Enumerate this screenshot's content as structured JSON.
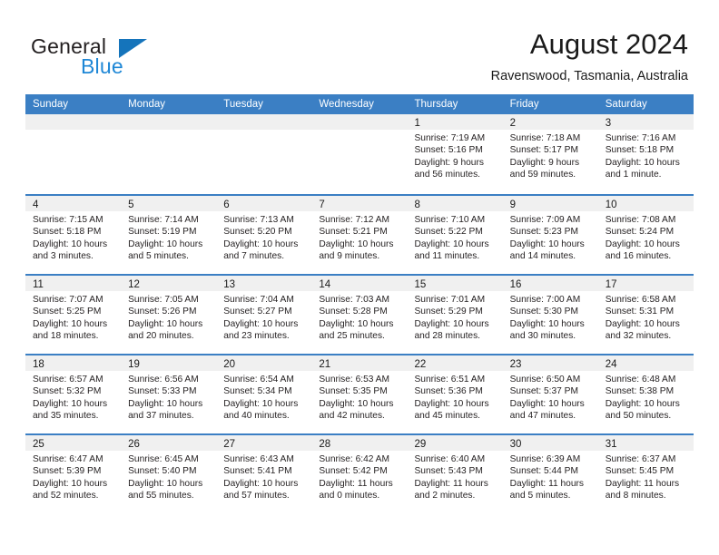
{
  "brand": {
    "name_top": "General",
    "name_bottom": "Blue",
    "triangle_color": "#1574bb",
    "blue_color": "#1e87d6"
  },
  "header": {
    "title": "August 2024",
    "subtitle": "Ravenswood, Tasmania, Australia"
  },
  "theme": {
    "header_blue": "#3b7fc4",
    "day_head_gray": "#f0f0f0",
    "text": "#231f20"
  },
  "weekdays": [
    "Sunday",
    "Monday",
    "Tuesday",
    "Wednesday",
    "Thursday",
    "Friday",
    "Saturday"
  ],
  "weeks": [
    [
      {
        "day": "",
        "lines": []
      },
      {
        "day": "",
        "lines": []
      },
      {
        "day": "",
        "lines": []
      },
      {
        "day": "",
        "lines": []
      },
      {
        "day": "1",
        "lines": [
          "Sunrise: 7:19 AM",
          "Sunset: 5:16 PM",
          "Daylight: 9 hours",
          "and 56 minutes."
        ]
      },
      {
        "day": "2",
        "lines": [
          "Sunrise: 7:18 AM",
          "Sunset: 5:17 PM",
          "Daylight: 9 hours",
          "and 59 minutes."
        ]
      },
      {
        "day": "3",
        "lines": [
          "Sunrise: 7:16 AM",
          "Sunset: 5:18 PM",
          "Daylight: 10 hours",
          "and 1 minute."
        ]
      }
    ],
    [
      {
        "day": "4",
        "lines": [
          "Sunrise: 7:15 AM",
          "Sunset: 5:18 PM",
          "Daylight: 10 hours",
          "and 3 minutes."
        ]
      },
      {
        "day": "5",
        "lines": [
          "Sunrise: 7:14 AM",
          "Sunset: 5:19 PM",
          "Daylight: 10 hours",
          "and 5 minutes."
        ]
      },
      {
        "day": "6",
        "lines": [
          "Sunrise: 7:13 AM",
          "Sunset: 5:20 PM",
          "Daylight: 10 hours",
          "and 7 minutes."
        ]
      },
      {
        "day": "7",
        "lines": [
          "Sunrise: 7:12 AM",
          "Sunset: 5:21 PM",
          "Daylight: 10 hours",
          "and 9 minutes."
        ]
      },
      {
        "day": "8",
        "lines": [
          "Sunrise: 7:10 AM",
          "Sunset: 5:22 PM",
          "Daylight: 10 hours",
          "and 11 minutes."
        ]
      },
      {
        "day": "9",
        "lines": [
          "Sunrise: 7:09 AM",
          "Sunset: 5:23 PM",
          "Daylight: 10 hours",
          "and 14 minutes."
        ]
      },
      {
        "day": "10",
        "lines": [
          "Sunrise: 7:08 AM",
          "Sunset: 5:24 PM",
          "Daylight: 10 hours",
          "and 16 minutes."
        ]
      }
    ],
    [
      {
        "day": "11",
        "lines": [
          "Sunrise: 7:07 AM",
          "Sunset: 5:25 PM",
          "Daylight: 10 hours",
          "and 18 minutes."
        ]
      },
      {
        "day": "12",
        "lines": [
          "Sunrise: 7:05 AM",
          "Sunset: 5:26 PM",
          "Daylight: 10 hours",
          "and 20 minutes."
        ]
      },
      {
        "day": "13",
        "lines": [
          "Sunrise: 7:04 AM",
          "Sunset: 5:27 PM",
          "Daylight: 10 hours",
          "and 23 minutes."
        ]
      },
      {
        "day": "14",
        "lines": [
          "Sunrise: 7:03 AM",
          "Sunset: 5:28 PM",
          "Daylight: 10 hours",
          "and 25 minutes."
        ]
      },
      {
        "day": "15",
        "lines": [
          "Sunrise: 7:01 AM",
          "Sunset: 5:29 PM",
          "Daylight: 10 hours",
          "and 28 minutes."
        ]
      },
      {
        "day": "16",
        "lines": [
          "Sunrise: 7:00 AM",
          "Sunset: 5:30 PM",
          "Daylight: 10 hours",
          "and 30 minutes."
        ]
      },
      {
        "day": "17",
        "lines": [
          "Sunrise: 6:58 AM",
          "Sunset: 5:31 PM",
          "Daylight: 10 hours",
          "and 32 minutes."
        ]
      }
    ],
    [
      {
        "day": "18",
        "lines": [
          "Sunrise: 6:57 AM",
          "Sunset: 5:32 PM",
          "Daylight: 10 hours",
          "and 35 minutes."
        ]
      },
      {
        "day": "19",
        "lines": [
          "Sunrise: 6:56 AM",
          "Sunset: 5:33 PM",
          "Daylight: 10 hours",
          "and 37 minutes."
        ]
      },
      {
        "day": "20",
        "lines": [
          "Sunrise: 6:54 AM",
          "Sunset: 5:34 PM",
          "Daylight: 10 hours",
          "and 40 minutes."
        ]
      },
      {
        "day": "21",
        "lines": [
          "Sunrise: 6:53 AM",
          "Sunset: 5:35 PM",
          "Daylight: 10 hours",
          "and 42 minutes."
        ]
      },
      {
        "day": "22",
        "lines": [
          "Sunrise: 6:51 AM",
          "Sunset: 5:36 PM",
          "Daylight: 10 hours",
          "and 45 minutes."
        ]
      },
      {
        "day": "23",
        "lines": [
          "Sunrise: 6:50 AM",
          "Sunset: 5:37 PM",
          "Daylight: 10 hours",
          "and 47 minutes."
        ]
      },
      {
        "day": "24",
        "lines": [
          "Sunrise: 6:48 AM",
          "Sunset: 5:38 PM",
          "Daylight: 10 hours",
          "and 50 minutes."
        ]
      }
    ],
    [
      {
        "day": "25",
        "lines": [
          "Sunrise: 6:47 AM",
          "Sunset: 5:39 PM",
          "Daylight: 10 hours",
          "and 52 minutes."
        ]
      },
      {
        "day": "26",
        "lines": [
          "Sunrise: 6:45 AM",
          "Sunset: 5:40 PM",
          "Daylight: 10 hours",
          "and 55 minutes."
        ]
      },
      {
        "day": "27",
        "lines": [
          "Sunrise: 6:43 AM",
          "Sunset: 5:41 PM",
          "Daylight: 10 hours",
          "and 57 minutes."
        ]
      },
      {
        "day": "28",
        "lines": [
          "Sunrise: 6:42 AM",
          "Sunset: 5:42 PM",
          "Daylight: 11 hours",
          "and 0 minutes."
        ]
      },
      {
        "day": "29",
        "lines": [
          "Sunrise: 6:40 AM",
          "Sunset: 5:43 PM",
          "Daylight: 11 hours",
          "and 2 minutes."
        ]
      },
      {
        "day": "30",
        "lines": [
          "Sunrise: 6:39 AM",
          "Sunset: 5:44 PM",
          "Daylight: 11 hours",
          "and 5 minutes."
        ]
      },
      {
        "day": "31",
        "lines": [
          "Sunrise: 6:37 AM",
          "Sunset: 5:45 PM",
          "Daylight: 11 hours",
          "and 8 minutes."
        ]
      }
    ]
  ]
}
